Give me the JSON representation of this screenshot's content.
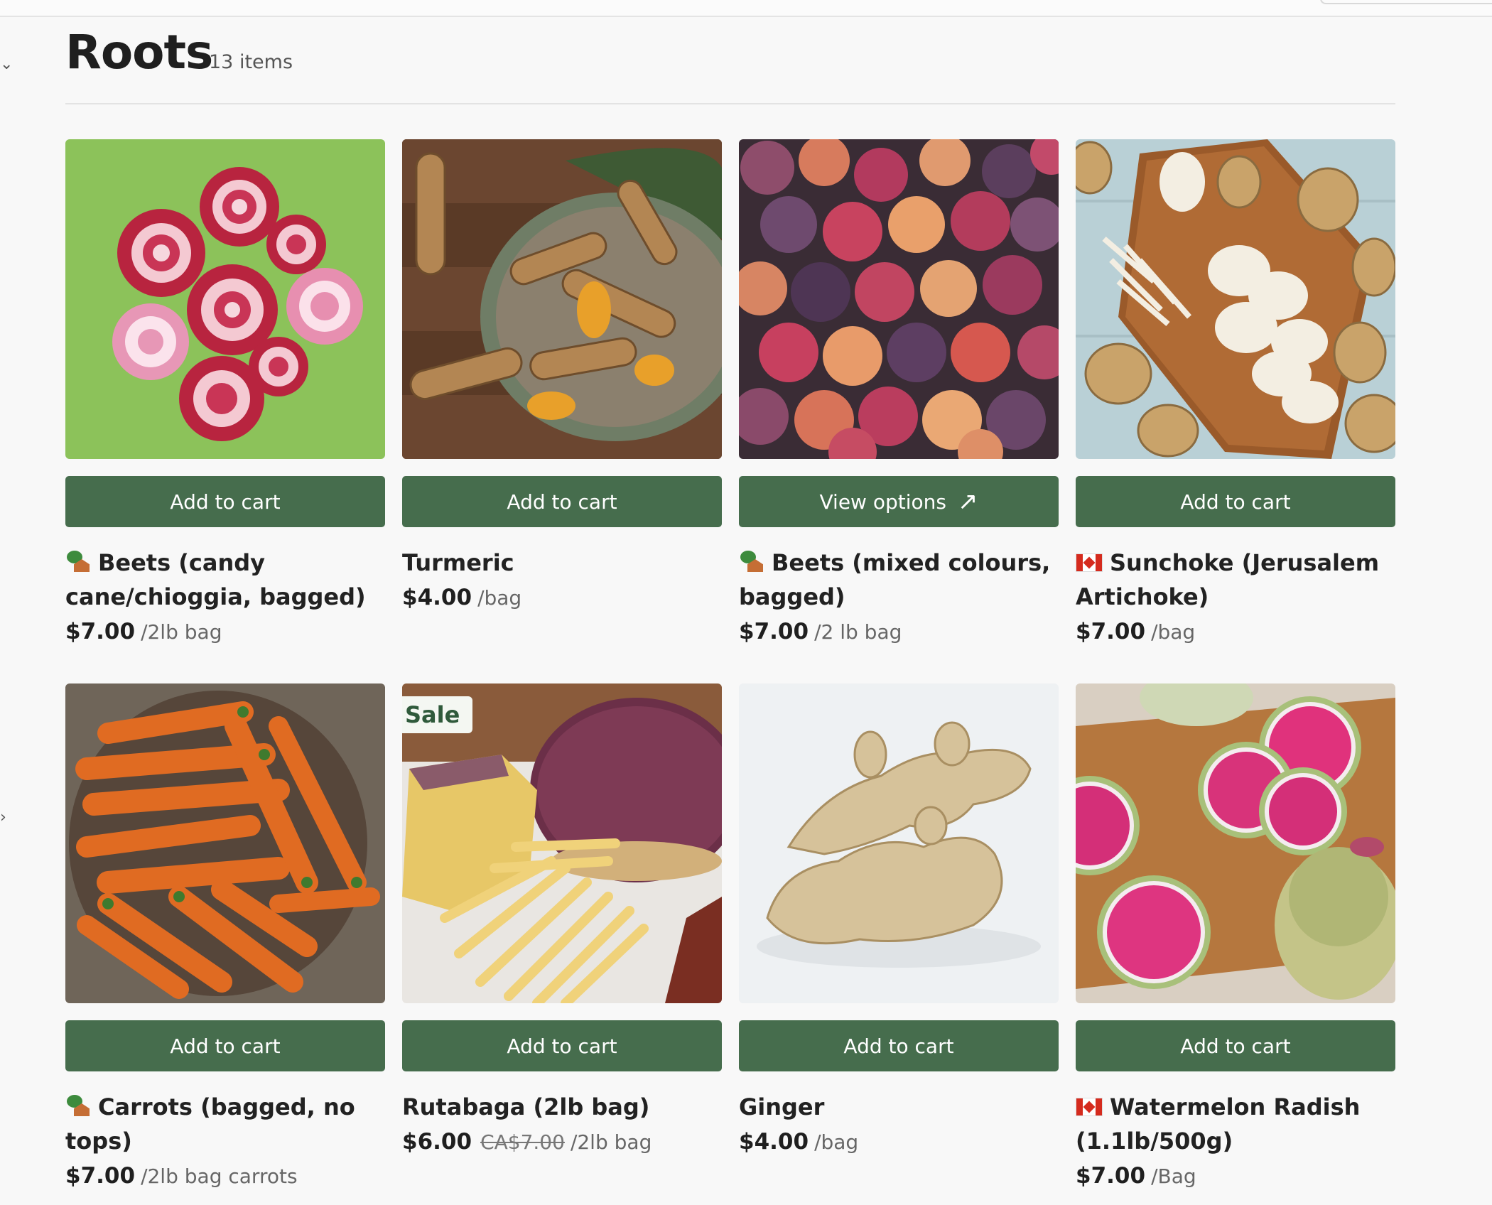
{
  "header": {
    "title": "Roots",
    "count": "13 items"
  },
  "colors": {
    "button": "#466d4d",
    "sale_badge_text": "#2f5a3b"
  },
  "products": [
    {
      "name": "Beets (candy cane/chioggia, bagged)",
      "badge_icon": "farm-hut-icon",
      "price": "$7.00",
      "old_price": "",
      "unit": "/2lb bag",
      "button": "Add to cart",
      "sale": ""
    },
    {
      "name": "Turmeric",
      "badge_icon": "",
      "price": "$4.00",
      "old_price": "",
      "unit": "/bag",
      "button": "Add to cart",
      "sale": ""
    },
    {
      "name": "Beets (mixed colours, bagged)",
      "badge_icon": "farm-hut-icon",
      "price": "$7.00",
      "old_price": "",
      "unit": "/2 lb bag",
      "button": "View options",
      "sale": ""
    },
    {
      "name": "Sunchoke (Jerusalem Artichoke)",
      "badge_icon": "canada-flag-icon",
      "price": "$7.00",
      "old_price": "",
      "unit": "/bag",
      "button": "Add to cart",
      "sale": ""
    },
    {
      "name": "Carrots (bagged, no tops)",
      "badge_icon": "farm-hut-icon",
      "price": "$7.00",
      "old_price": "",
      "unit": "/2lb bag carrots",
      "button": "Add to cart",
      "sale": ""
    },
    {
      "name": "Rutabaga (2lb bag)",
      "badge_icon": "",
      "price": "$6.00",
      "old_price": "CA$7.00",
      "unit": "/2lb bag",
      "button": "Add to cart",
      "sale": "Sale"
    },
    {
      "name": "Ginger",
      "badge_icon": "",
      "price": "$4.00",
      "old_price": "",
      "unit": "/bag",
      "button": "Add to cart",
      "sale": ""
    },
    {
      "name": "Watermelon Radish (1.1lb/500g)",
      "badge_icon": "canada-flag-icon",
      "price": "$7.00",
      "old_price": "",
      "unit": "/Bag",
      "button": "Add to cart",
      "sale": ""
    }
  ]
}
